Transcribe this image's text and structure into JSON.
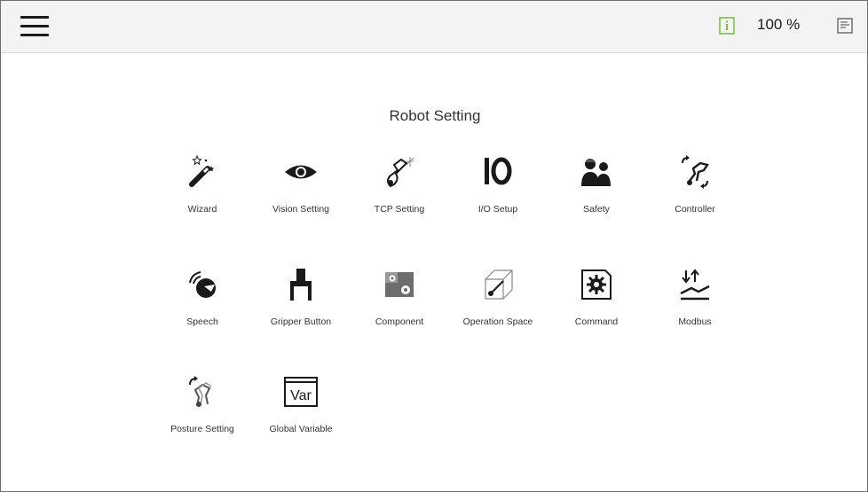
{
  "header": {
    "status_icon": "info-icon",
    "status_color": "#7cc242",
    "zoom": "100 %"
  },
  "page": {
    "title": "Robot Setting"
  },
  "items": [
    {
      "label": "Wizard",
      "icon": "wand-icon"
    },
    {
      "label": "Vision Setting",
      "icon": "eye-icon"
    },
    {
      "label": "TCP Setting",
      "icon": "tcp-icon"
    },
    {
      "label": "I/O Setup",
      "icon": "io-icon"
    },
    {
      "label": "Safety",
      "icon": "people-icon"
    },
    {
      "label": "Controller",
      "icon": "controller-icon"
    },
    {
      "label": "Speech",
      "icon": "speech-icon"
    },
    {
      "label": "Gripper Button",
      "icon": "gripper-icon"
    },
    {
      "label": "Component",
      "icon": "component-icon"
    },
    {
      "label": "Operation Space",
      "icon": "operation-space-icon"
    },
    {
      "label": "Command",
      "icon": "command-icon"
    },
    {
      "label": "Modbus",
      "icon": "modbus-icon"
    },
    {
      "label": "Posture Setting",
      "icon": "posture-icon"
    },
    {
      "label": "Global Variable",
      "icon": "var-icon",
      "icon_text": "Var"
    }
  ]
}
